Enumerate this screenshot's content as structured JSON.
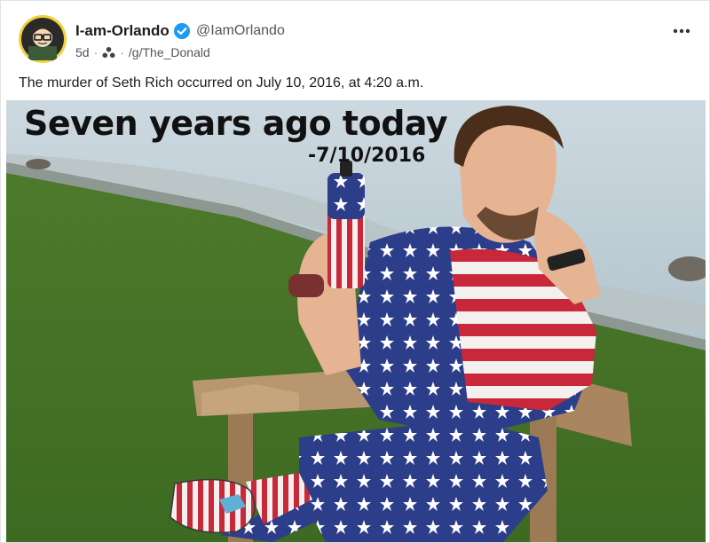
{
  "post": {
    "display_name": "I-am-Orlando",
    "handle": "@IamOrlando",
    "age": "5d",
    "community": "/g/The_Donald",
    "body": "The murder of Seth Rich occurred on July 10, 2016, at 4:20 a.m.",
    "verified": true
  },
  "image": {
    "overlay_title": "Seven years ago today",
    "overlay_date": "-7/10/2016"
  },
  "icons": {
    "verified": "verified-badge-icon",
    "community": "community-icon",
    "more": "more-options-icon"
  },
  "colors": {
    "verified_blue": "#1d9bf0",
    "avatar_bg": "#f2d13a"
  }
}
